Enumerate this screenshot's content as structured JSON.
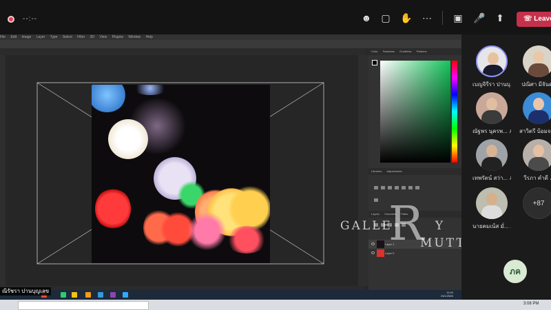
{
  "teams": {
    "timer": "--:--",
    "leave_label": "Leave",
    "icons": [
      "people-icon",
      "chat-icon",
      "reactions-icon",
      "more-icon",
      "camera-off-icon",
      "mic-off-icon",
      "share-icon"
    ]
  },
  "photoshop": {
    "menu": [
      "File",
      "Edit",
      "Image",
      "Layer",
      "Type",
      "Select",
      "Filter",
      "3D",
      "View",
      "Plugins",
      "Window",
      "Help"
    ],
    "color_panel_tabs": [
      "Color",
      "Swatches",
      "Gradients",
      "Patterns"
    ],
    "adjust_tabs": [
      "Libraries",
      "Adjustments"
    ],
    "layers_tabs": [
      "Layers",
      "Channels",
      "Paths"
    ],
    "layers": [
      {
        "name": "Layer 1",
        "selected": true
      },
      {
        "name": "Layer 0",
        "selected": false
      }
    ],
    "accent_green": "#14c45a"
  },
  "screen": {
    "presenter_name": "ณิรัชรา ปานบุญเลข",
    "windows_clock_time": "11:00",
    "windows_clock_date": "25/1/2565"
  },
  "watermark": {
    "letter": "R",
    "left_word": "GALLE",
    "left_word_end": "Y",
    "right_word": "MUTT"
  },
  "participants": [
    {
      "name": "เบญจิรีรา ปานบุ...",
      "muted": false,
      "ring": true,
      "skin": "#e8c2a0",
      "cloth": "#1a1a2e",
      "bg": "#e6e6ea"
    },
    {
      "name": "ปณิศา มีจันดา",
      "muted": false,
      "ring": false,
      "skin": "#e9c8aa",
      "cloth": "#6a4a3a",
      "bg": "#d9d3c8"
    },
    {
      "name": "ณัฐพร นุครพ...",
      "muted": true,
      "ring": false,
      "skin": "#e2bea0",
      "cloth": "#3b3b3b",
      "bg": "#c9a89a"
    },
    {
      "name": "สาวิตรี บ้อมจ...",
      "muted": true,
      "ring": false,
      "skin": "#e8c6ac",
      "cloth": "#1d2f6b",
      "bg": "#3b8bd6"
    },
    {
      "name": "เทพรัตน์ สว่า...",
      "muted": true,
      "ring": false,
      "skin": "#d9b493",
      "cloth": "#222",
      "bg": "#9ea3a8"
    },
    {
      "name": "วีรภา คำดี",
      "muted": true,
      "ring": false,
      "skin": "#e5c0a3",
      "cloth": "#4b4b4b",
      "bg": "#b8b0a8"
    },
    {
      "name": "นายคมเน้ส มั่...",
      "muted": true,
      "ring": false,
      "skin": "#d6b08a",
      "cloth": "#ddd",
      "bg": "#bdbdb0"
    }
  ],
  "more_count": "+87",
  "self_initials": "ภค",
  "host_clock": "3:08 PM"
}
